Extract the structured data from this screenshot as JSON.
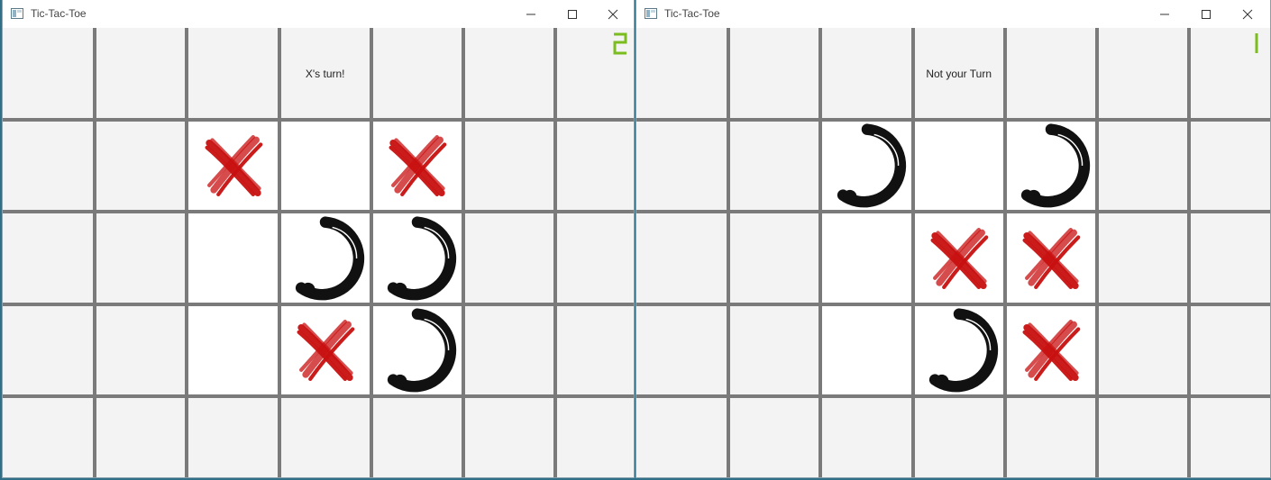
{
  "accent": "#7bbd1f",
  "x_color": "#c81010",
  "o_color": "#111111",
  "windows": [
    {
      "title": "Tic-Tac-Toe",
      "status": "X's turn!",
      "player_number": "2",
      "board": [
        [
          "",
          "",
          "",
          "",
          "",
          "",
          ""
        ],
        [
          "",
          "",
          "X",
          "",
          "X",
          "",
          ""
        ],
        [
          "",
          "",
          "",
          "O",
          "O",
          "",
          ""
        ],
        [
          "",
          "",
          "",
          "X",
          "O",
          "",
          ""
        ],
        [
          "",
          "",
          "",
          "",
          "",
          "",
          ""
        ]
      ]
    },
    {
      "title": "Tic-Tac-Toe",
      "status": "Not your Turn",
      "player_number": "1",
      "board": [
        [
          "",
          "",
          "",
          "",
          "",
          "",
          ""
        ],
        [
          "",
          "",
          "O",
          "",
          "O",
          "",
          ""
        ],
        [
          "",
          "",
          "",
          "X",
          "X",
          "",
          ""
        ],
        [
          "",
          "",
          "",
          "O",
          "X",
          "",
          ""
        ],
        [
          "",
          "",
          "",
          "",
          "",
          "",
          ""
        ]
      ]
    }
  ],
  "controls": {
    "minimize_icon": "minimize-icon",
    "maximize_icon": "maximize-icon",
    "close_icon": "close-icon"
  }
}
